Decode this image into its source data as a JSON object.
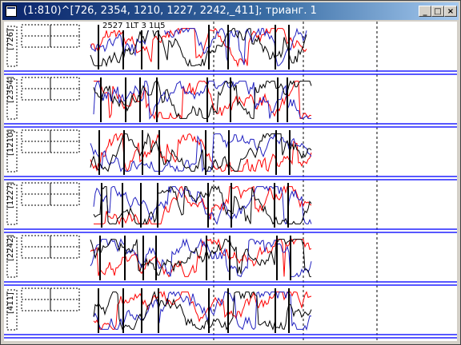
{
  "window": {
    "title": "(1:810)^[726, 2354, 1210, 1227, 2242,_411]; трианг. 1",
    "buttons": {
      "minimize": "_",
      "maximize": "□",
      "close": "×"
    }
  },
  "top_legend": "2527 1LT 3 1Ц5",
  "rows": [
    {
      "label": "[726]"
    },
    {
      "label": "[2354]"
    },
    {
      "label": "[1210]"
    },
    {
      "label": "[1227]"
    },
    {
      "label": "[2242]"
    },
    {
      "label": "[411]"
    }
  ],
  "colors": {
    "separator": "#2020ff",
    "red_trace": "#ff0000",
    "blue_trace": "#2020c0",
    "black_trace": "#000000",
    "titlebar": "#0a246a"
  }
}
